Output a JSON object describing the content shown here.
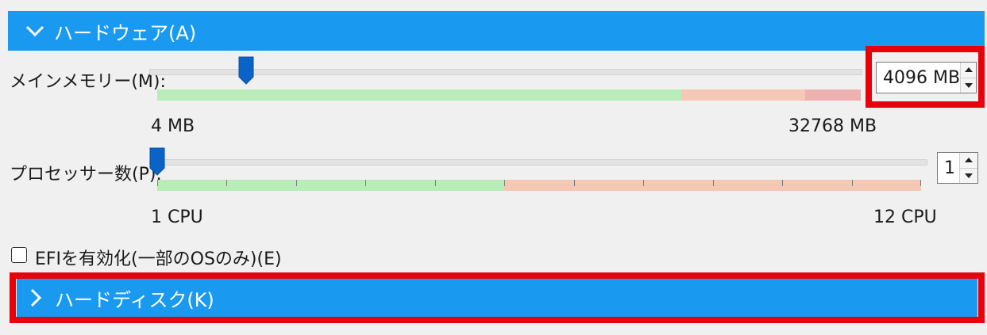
{
  "hardware": {
    "header_label": "ハードウェア(A)",
    "memory": {
      "label": "メインメモリー(M):",
      "value": "4096 MB",
      "min_label": "4 MB",
      "max_label": "32768 MB",
      "slider_fraction": 0.125
    },
    "processors": {
      "label": "プロセッサー数(P):",
      "value": "1",
      "min_label": "1 CPU",
      "max_label": "12 CPU",
      "slider_fraction": 0.0
    },
    "efi": {
      "label": "EFIを有効化(一部のOSのみ)(E)",
      "checked": false
    }
  },
  "hard_disk": {
    "header_label": "ハードディスク(K)"
  },
  "colors": {
    "header_bg": "#1a99f0",
    "highlight_red": "#e8000b",
    "scale_green": "#b8ecb8",
    "scale_orange": "#f4c8b4",
    "scale_red": "#efb0b0",
    "thumb_blue": "#0a64c8"
  },
  "icons": {
    "expanded": "chevron-down-icon",
    "collapsed": "chevron-right-icon",
    "spin_up": "spin-up-icon",
    "spin_down": "spin-down-icon"
  }
}
